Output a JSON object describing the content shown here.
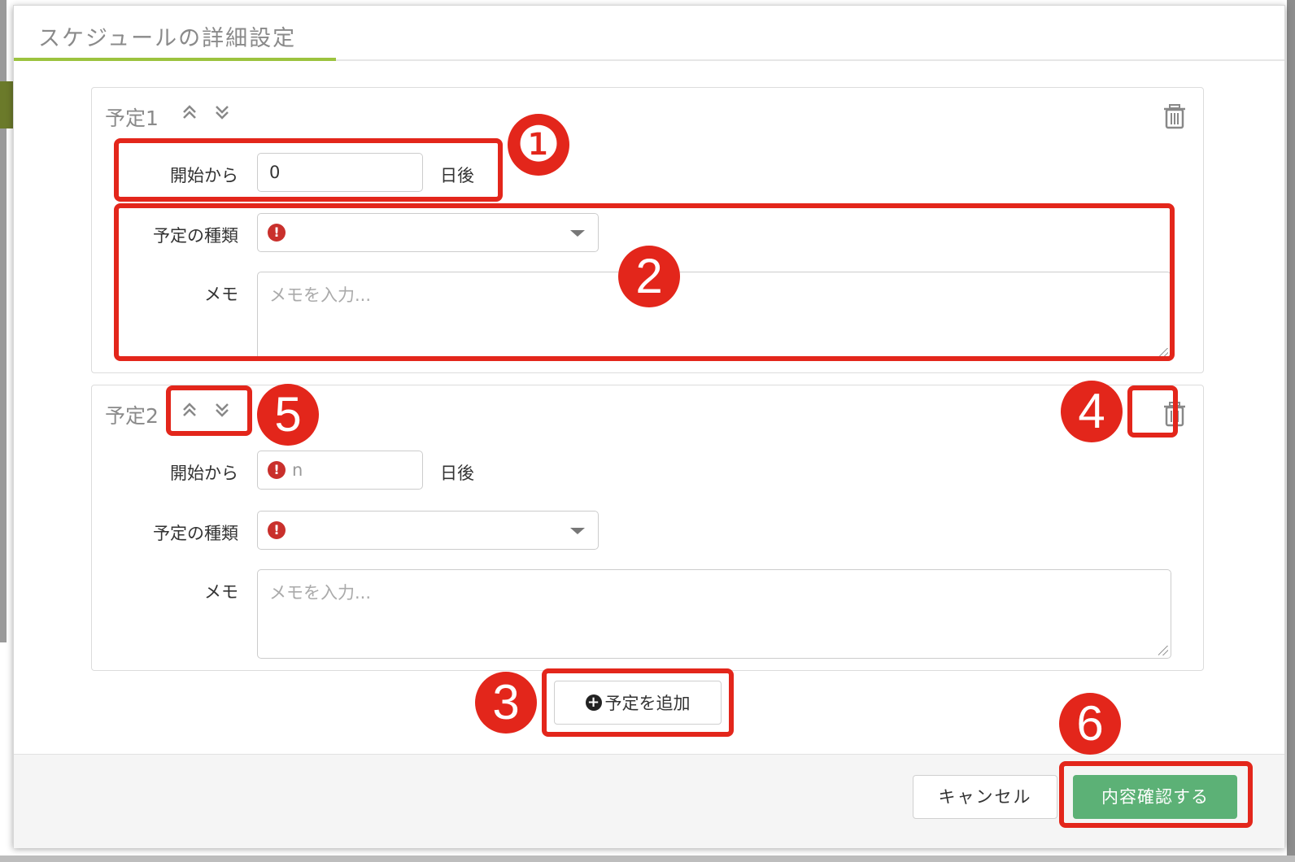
{
  "dialog": {
    "title": "スケジュールの詳細設定"
  },
  "schedules": [
    {
      "title": "予定1",
      "start_label": "開始から",
      "start_value": "0",
      "start_unit": "日後",
      "type_label": "予定の種類",
      "type_value": "",
      "memo_label": "メモ",
      "memo_placeholder": "メモを入力..."
    },
    {
      "title": "予定2",
      "start_label": "開始から",
      "start_value": "n",
      "start_unit": "日後",
      "type_label": "予定の種類",
      "type_value": "",
      "memo_label": "メモ",
      "memo_placeholder": "メモを入力..."
    }
  ],
  "icons": {
    "move_up": "⌃",
    "move_down": "⌄",
    "delete": "trash-icon",
    "error": "!",
    "add": "+"
  },
  "add_button_label": "予定を追加",
  "footer": {
    "cancel_label": "キャンセル",
    "confirm_label": "内容確認する"
  },
  "annotations": [
    "❶",
    "2",
    "3",
    "4",
    "5",
    "6"
  ],
  "colors": {
    "accent_green": "#9cc33f",
    "confirm_green": "#5cb176",
    "annotation_red": "#e3261b",
    "error_red": "#c9302c"
  }
}
